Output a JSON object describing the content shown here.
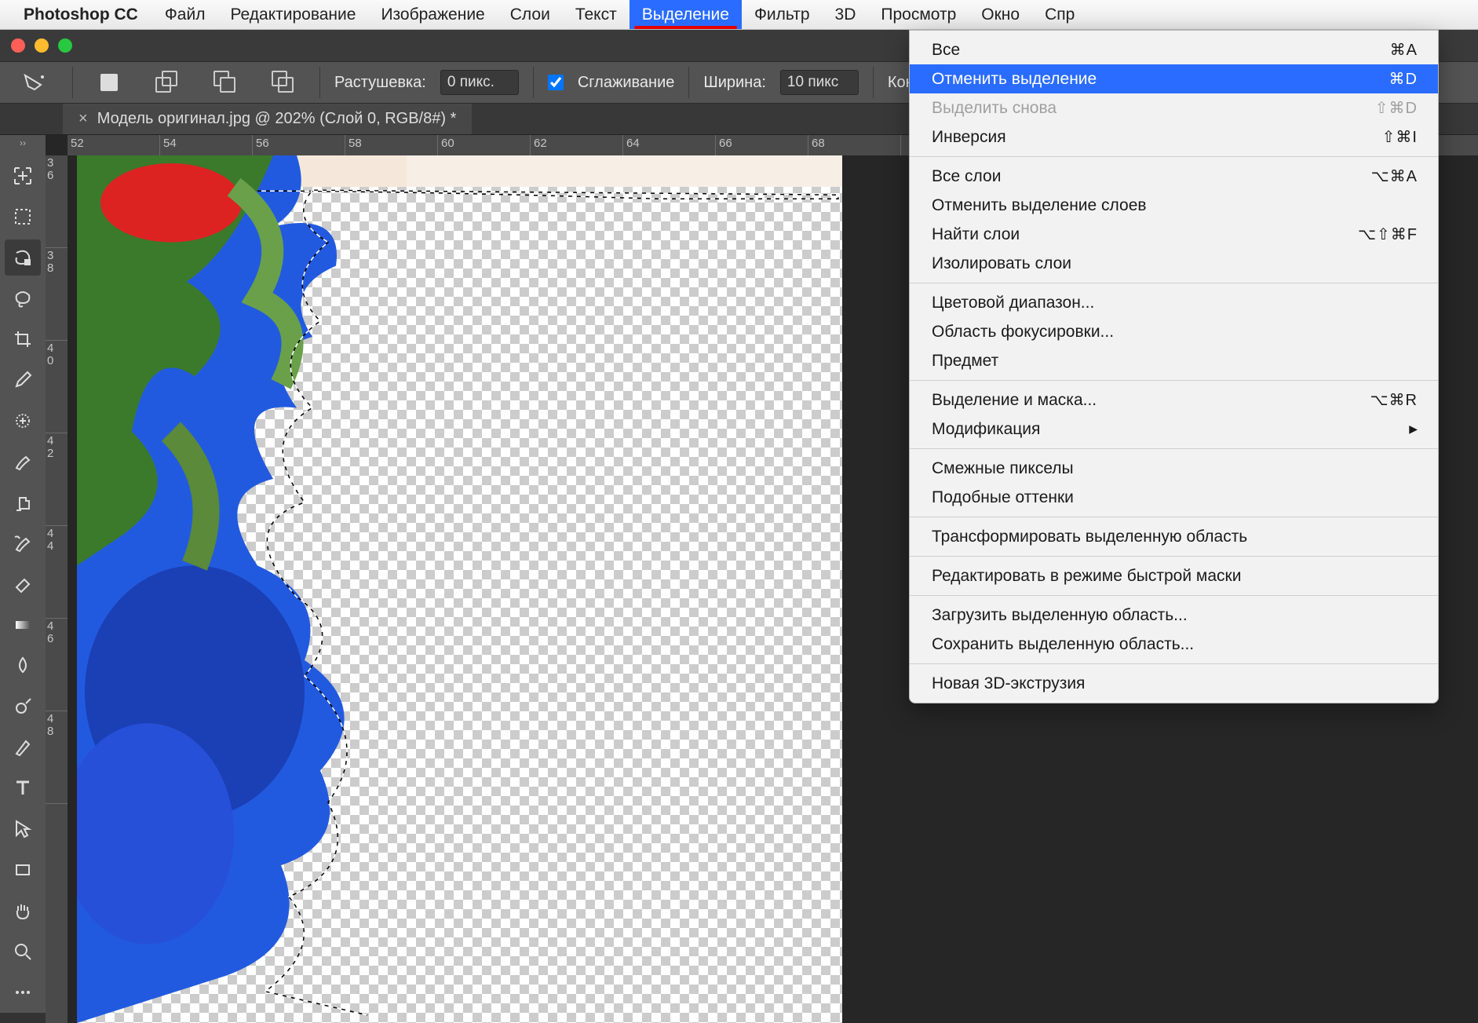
{
  "menubar": {
    "app": "Photoshop CC",
    "items": [
      "Файл",
      "Редактирование",
      "Изображение",
      "Слои",
      "Текст",
      "Выделение",
      "Фильтр",
      "3D",
      "Просмотр",
      "Окно",
      "Спр"
    ],
    "open_index": 5
  },
  "dropdown": {
    "groups": [
      [
        {
          "label": "Все",
          "shortcut": "⌘A"
        },
        {
          "label": "Отменить выделение",
          "shortcut": "⌘D",
          "highlight": true
        },
        {
          "label": "Выделить снова",
          "shortcut": "⇧⌘D",
          "disabled": true
        },
        {
          "label": "Инверсия",
          "shortcut": "⇧⌘I"
        }
      ],
      [
        {
          "label": "Все слои",
          "shortcut": "⌥⌘A"
        },
        {
          "label": "Отменить выделение слоев"
        },
        {
          "label": "Найти слои",
          "shortcut": "⌥⇧⌘F"
        },
        {
          "label": "Изолировать слои"
        }
      ],
      [
        {
          "label": "Цветовой диапазон..."
        },
        {
          "label": "Область фокусировки..."
        },
        {
          "label": "Предмет"
        }
      ],
      [
        {
          "label": "Выделение и маска...",
          "shortcut": "⌥⌘R"
        },
        {
          "label": "Модификация",
          "submenu": true
        }
      ],
      [
        {
          "label": "Смежные пикселы"
        },
        {
          "label": "Подобные оттенки"
        }
      ],
      [
        {
          "label": "Трансформировать выделенную область"
        }
      ],
      [
        {
          "label": "Редактировать в режиме быстрой маски"
        }
      ],
      [
        {
          "label": "Загрузить выделенную область..."
        },
        {
          "label": "Сохранить выделенную область..."
        }
      ],
      [
        {
          "label": "Новая 3D-экструзия"
        }
      ]
    ]
  },
  "options": {
    "feather_label": "Растушевка:",
    "feather_value": "0 пикс.",
    "antialias_label": "Сглаживание",
    "antialias_checked": true,
    "width_label": "Ширина:",
    "width_value": "10 пикс",
    "contrast_label": "Контраст"
  },
  "tab": {
    "title": "Модель оригинал.jpg @ 202% (Слой 0, RGB/8#) *"
  },
  "ruler": {
    "top": [
      "52",
      "54",
      "56",
      "58",
      "60",
      "62",
      "64",
      "66",
      "68"
    ],
    "left": [
      "36",
      "38",
      "40",
      "42",
      "44",
      "46",
      "48"
    ]
  },
  "tools": [
    "move",
    "marquee",
    "magnetic-lasso",
    "lasso",
    "crop",
    "eyedropper",
    "spot-heal",
    "brush",
    "clone",
    "history-brush",
    "eraser",
    "gradient",
    "blur",
    "dodge",
    "pen",
    "type",
    "path-select",
    "rectangle",
    "hand",
    "zoom",
    "more"
  ],
  "active_tool_index": 2
}
